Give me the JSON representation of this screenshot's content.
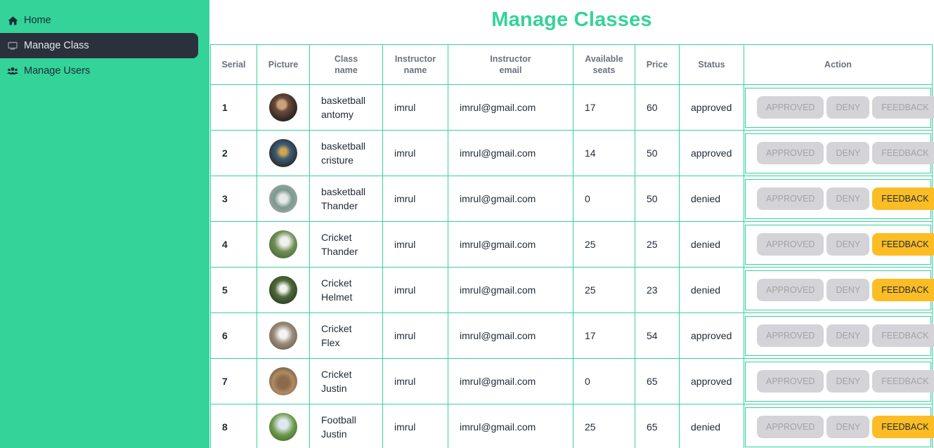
{
  "sidebar": {
    "items": [
      {
        "label": "Home",
        "icon": "home-icon"
      },
      {
        "label": "Manage Class",
        "icon": "monitor-icon",
        "active": true
      },
      {
        "label": "Manage Users",
        "icon": "users-icon"
      }
    ]
  },
  "main": {
    "title": "Manage Classes",
    "columns": [
      "Serial",
      "Picture",
      "Class name",
      "Instructor name",
      "Instructor email",
      "Available seats",
      "Price",
      "Status",
      "Action"
    ],
    "action_labels": {
      "approve": "APPROVED",
      "deny": "DENY",
      "feedback": "FEEDBACK"
    },
    "rows": [
      {
        "serial": "1",
        "class_name": "basketball antomy",
        "instructor": "imrul",
        "email": "imrul@gmail.com",
        "seats": "17",
        "price": "60",
        "status": "approved",
        "feedback_enabled": false
      },
      {
        "serial": "2",
        "class_name": "basketball cristure",
        "instructor": "imrul",
        "email": "imrul@gmail.com",
        "seats": "14",
        "price": "50",
        "status": "approved",
        "feedback_enabled": false
      },
      {
        "serial": "3",
        "class_name": "basketball Thander",
        "instructor": "imrul",
        "email": "imrul@gmail.com",
        "seats": "0",
        "price": "50",
        "status": "denied",
        "feedback_enabled": true
      },
      {
        "serial": "4",
        "class_name": "Cricket Thander",
        "instructor": "imrul",
        "email": "imrul@gmail.com",
        "seats": "25",
        "price": "25",
        "status": "denied",
        "feedback_enabled": true
      },
      {
        "serial": "5",
        "class_name": "Cricket Helmet",
        "instructor": "imrul",
        "email": "imrul@gmail.com",
        "seats": "25",
        "price": "23",
        "status": "denied",
        "feedback_enabled": true
      },
      {
        "serial": "6",
        "class_name": "Cricket Flex",
        "instructor": "imrul",
        "email": "imrul@gmail.com",
        "seats": "17",
        "price": "54",
        "status": "approved",
        "feedback_enabled": false
      },
      {
        "serial": "7",
        "class_name": "Cricket Justin",
        "instructor": "imrul",
        "email": "imrul@gmail.com",
        "seats": "0",
        "price": "65",
        "status": "approved",
        "feedback_enabled": false
      },
      {
        "serial": "8",
        "class_name": "Football Justin",
        "instructor": "imrul",
        "email": "imrul@gmail.com",
        "seats": "25",
        "price": "65",
        "status": "denied",
        "feedback_enabled": true
      }
    ]
  },
  "colors": {
    "accent": "#34d399",
    "sidebar_bg": "#33d399",
    "active_nav": "#2a303c",
    "feedback": "#fbbd23",
    "disabled": "#d4d4d8"
  }
}
